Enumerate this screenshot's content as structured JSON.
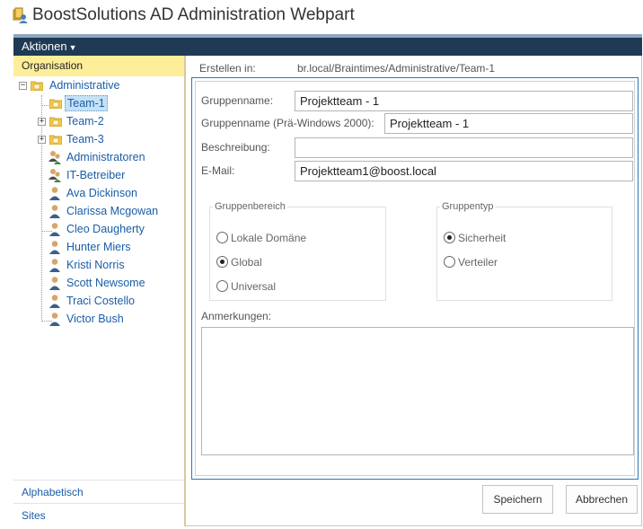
{
  "header": {
    "title": "BoostSolutions AD Administration Webpart",
    "app_icon": "ad-admin-icon"
  },
  "actions_menu": {
    "label": "Aktionen"
  },
  "left_nav": {
    "organisation_label": "Organisation",
    "alphabetical_label": "Alphabetisch",
    "sites_label": "Sites",
    "tree": {
      "root": "Administrative",
      "items": [
        {
          "label": "Team-1",
          "type": "ou"
        },
        {
          "label": "Team-2",
          "type": "ou"
        },
        {
          "label": "Team-3",
          "type": "ou"
        },
        {
          "label": "Administratoren",
          "type": "group"
        },
        {
          "label": "IT-Betreiber",
          "type": "group"
        },
        {
          "label": "Ava Dickinson",
          "type": "user"
        },
        {
          "label": "Clarissa Mcgowan",
          "type": "user"
        },
        {
          "label": "Cleo Daugherty",
          "type": "user"
        },
        {
          "label": "Hunter Miers",
          "type": "user"
        },
        {
          "label": "Kristi Norris",
          "type": "user"
        },
        {
          "label": "Scott Newsome",
          "type": "user"
        },
        {
          "label": "Traci Costello",
          "type": "user"
        },
        {
          "label": "Victor Bush",
          "type": "user"
        }
      ]
    }
  },
  "form": {
    "created_in_label": "Erstellen in:",
    "created_in_path": "br.local/Braintimes/Administrative/Team-1",
    "group_name_label": "Gruppenname:",
    "group_name_value": "Projektteam - 1",
    "group_name_pre2000_label": "Gruppenname (Prä-Windows 2000):",
    "group_name_pre2000_value": "Projektteam - 1",
    "description_label": "Beschreibung:",
    "description_value": "",
    "email_label": "E-Mail:",
    "email_value": "Projektteam1@boost.local",
    "scope": {
      "legend": "Gruppenbereich",
      "options": [
        "Lokale Domäne",
        "Global",
        "Universal"
      ],
      "selected": "Global"
    },
    "type": {
      "legend": "Gruppentyp",
      "options": [
        "Sicherheit",
        "Verteiler"
      ],
      "selected": "Sicherheit"
    },
    "notes_label": "Anmerkungen:",
    "notes_value": ""
  },
  "buttons": {
    "save": "Speichern",
    "cancel": "Abbrechen"
  },
  "colors": {
    "actions_bar": "#1f3a55",
    "selected_nav": "#fdee9a",
    "link": "#1a5da8",
    "form_border": "#2a7ab8"
  }
}
